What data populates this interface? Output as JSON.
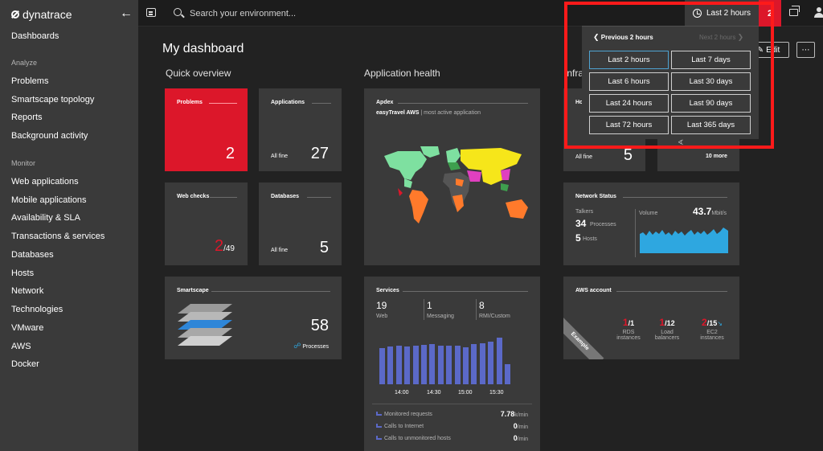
{
  "brand": {
    "name": "dynatrace"
  },
  "sidebar": {
    "dashboards": "Dashboards",
    "sections": [
      {
        "title": "Analyze",
        "items": [
          "Problems",
          "Smartscape topology",
          "Reports",
          "Background activity"
        ]
      },
      {
        "title": "Monitor",
        "items": [
          "Web applications",
          "Mobile applications",
          "Availability & SLA",
          "Transactions & services",
          "Databases",
          "Hosts",
          "Network",
          "Technologies",
          "VMware",
          "AWS",
          "Docker"
        ]
      }
    ]
  },
  "topbar": {
    "search_placeholder": "Search your environment...",
    "timeframe_label": "Last 2 hours",
    "problems_count": "2"
  },
  "dashboard": {
    "title": "My dashboard",
    "sections": {
      "quick": "Quick overview",
      "app": "Application health",
      "infra": "Infra"
    },
    "edit_label": "Edit",
    "more_label": "⋯",
    "tiles": {
      "problems": {
        "title": "Problems",
        "value": "2"
      },
      "applications": {
        "title": "Applications",
        "status": "All fine",
        "value": "27"
      },
      "webchecks": {
        "title": "Web checks",
        "failed": "2",
        "total": "/49"
      },
      "databases": {
        "title": "Databases",
        "status": "All fine",
        "value": "5"
      },
      "smartscape": {
        "title": "Smartscape",
        "value": "58",
        "label": "Processes"
      },
      "apdex": {
        "title": "Apdex",
        "app": "easyTravel AWS",
        "app_note": "| most active application"
      },
      "hosts": {
        "title": "Ho",
        "status": "All fine",
        "value": "5"
      },
      "hosts2": {
        "more": "10 more",
        "glyph": "∢"
      },
      "network": {
        "title": "Network Status",
        "talkers_label": "Talkers",
        "processes_value": "34",
        "processes_label": "Processes",
        "hosts_value": "5",
        "hosts_label": "Hosts",
        "volume_label": "Volume",
        "volume_value": "43.7",
        "volume_unit": "Mbit/s"
      },
      "services": {
        "title": "Services",
        "web_value": "19",
        "web_label": "Web",
        "msg_value": "1",
        "msg_label": "Messaging",
        "rmi_value": "8",
        "rmi_label": "RMI/Custom",
        "ticks": [
          "14:00",
          "14:30",
          "15:00",
          "15:30"
        ],
        "bars": [
          0.72,
          0.75,
          0.77,
          0.76,
          0.78,
          0.79,
          0.8,
          0.78,
          0.77,
          0.77,
          0.74,
          0.81,
          0.82,
          0.86,
          0.93,
          0.4
        ],
        "rows": [
          {
            "label": "Monitored requests",
            "value": "7.78",
            "unit": "k/min"
          },
          {
            "label": "Calls to Internet",
            "value": "0",
            "unit": "/min"
          },
          {
            "label": "Calls to unmonitored hosts",
            "value": "0",
            "unit": "/min"
          }
        ]
      },
      "aws": {
        "title": "AWS account",
        "banner": "Example",
        "items": [
          {
            "red": "1",
            "total": "/1",
            "label1": "RDS",
            "label2": "instances"
          },
          {
            "red": "1",
            "total": "/12",
            "label1": "Load",
            "label2": "balancers"
          },
          {
            "red": "2",
            "total": "/15",
            "label1": "EC2",
            "label2": "instances"
          }
        ]
      }
    }
  },
  "timeframe_popup": {
    "prev": "Previous 2 hours",
    "next": "Next 2 hours",
    "options": [
      "Last 2 hours",
      "Last 7 days",
      "Last 6 hours",
      "Last 30 days",
      "Last 24 hours",
      "Last 90 days",
      "Last 72 hours",
      "Last 365 days"
    ],
    "selected": "Last 2 hours"
  },
  "colors": {
    "accent": "#dc172a",
    "highlight": "#ff1a1a",
    "bars": "#5b69c8",
    "network": "#2ea7e0"
  }
}
